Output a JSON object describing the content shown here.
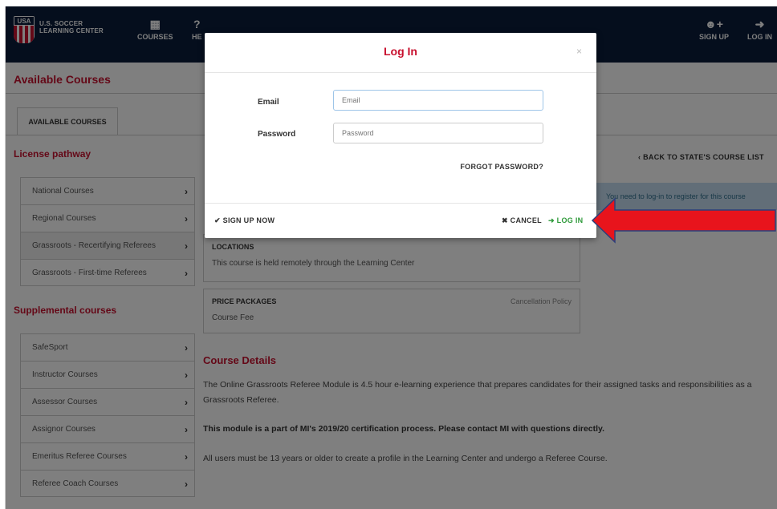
{
  "brand": {
    "logo_text": "USA",
    "name_line1": "U.S. SOCCER",
    "name_line2": "LEARNING CENTER"
  },
  "nav": {
    "courses": {
      "icon": "calendar-icon",
      "label": "COURSES"
    },
    "help": {
      "icon": "question-icon",
      "label": "HE"
    },
    "signup": {
      "icon": "add-user-icon",
      "label": "SIGN UP"
    },
    "login": {
      "icon": "sign-in-icon",
      "label": "LOG IN"
    }
  },
  "page": {
    "title": "Available Courses",
    "tab": "AVAILABLE COURSES",
    "license_title": "License pathway",
    "license_items": [
      "National Courses",
      "Regional Courses",
      "Grassroots - Recertifying Referees",
      "Grassroots - First-time Referees"
    ],
    "supplemental_title": "Supplemental courses",
    "supplemental_items": [
      "SafeSport",
      "Instructor Courses",
      "Assessor Courses",
      "Assignor Courses",
      "Emeritus Referee Courses",
      "Referee Coach Courses"
    ],
    "back_link": "BACK TO STATE'S COURSE LIST",
    "notice": "You need to log-in to register for this course",
    "locations_title": "LOCATIONS",
    "locations_text": "This course is held remotely through the Learning Center",
    "price_title": "PRICE PACKAGES",
    "price_text": "Course Fee",
    "cancellation": "Cancellation Policy",
    "details_title": "Course Details",
    "details_p1": "The Online Grassroots Referee Module is 4.5 hour e-learning experience that prepares candidates for their assigned tasks and responsibilities as a Grassroots Referee.",
    "details_p2": "This module is a part of MI's 2019/20 certification process. Please contact MI with questions directly.",
    "details_p3": "All users must be 13 years or older to create a profile in the Learning Center and undergo a Referee Course."
  },
  "modal": {
    "title": "Log In",
    "close": "×",
    "email_label": "Email",
    "email_placeholder": "Email",
    "password_label": "Password",
    "password_placeholder": "Password",
    "forgot": "FORGOT PASSWORD?",
    "signup_now": "SIGN UP NOW",
    "cancel": "CANCEL",
    "login": "LOG IN"
  },
  "colors": {
    "accent_red": "#c8102e",
    "nav_bg": "#0a1d3b",
    "login_green": "#2e9a3a",
    "arrow_red": "#e8141c"
  }
}
